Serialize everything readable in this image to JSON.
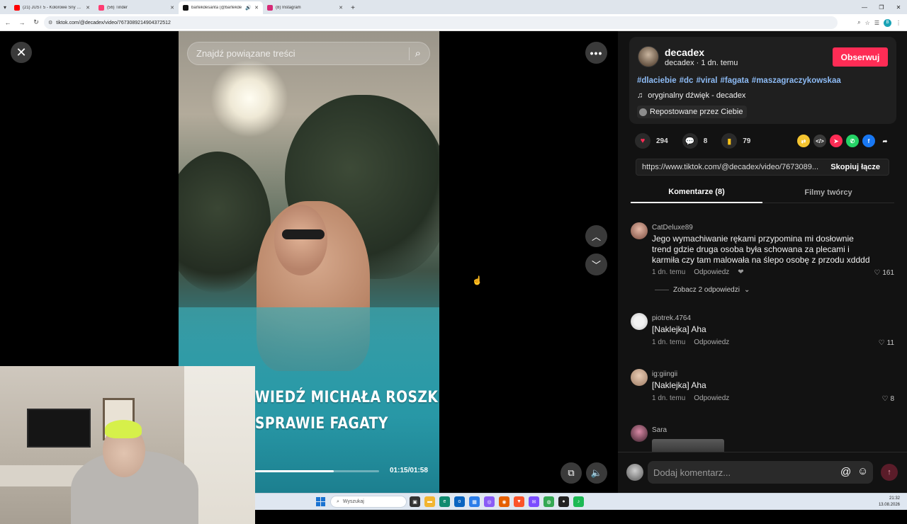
{
  "browser": {
    "tabs": [
      {
        "title": "(21) JUST 5 - Kolorowe Sny 202",
        "color": "#ff0000",
        "active": false
      },
      {
        "title": "(56) Tinder",
        "color": "#fe3c72",
        "active": false
      },
      {
        "title": "bartekdesanta (@bartekde",
        "color": "#111111",
        "active": true
      },
      {
        "title": "(8) Instagram",
        "color": "#d62976",
        "active": false
      }
    ],
    "url": "tiktok.com/@decadex/video/7673089214904372512"
  },
  "video": {
    "search_placeholder": "Znajdź powiązane treści",
    "caption_line1": "WIEDŹ MICHAŁA ROSZKI",
    "caption_line2": "SPRAWIE FAGATY",
    "timecode": "01:15/01:58",
    "progress_fraction": 0.636
  },
  "post": {
    "username": "decadex",
    "subline": "decadex · 1 dn. temu",
    "follow_label": "Obserwuj",
    "hashtags": [
      "#dlaciebie",
      "#dc",
      "#viral",
      "#fagata",
      "#maszagraczykowskaa"
    ],
    "sound": "oryginalny dźwięk - decadex",
    "repost": "Repostowane przez Ciebie",
    "likes": "294",
    "comments": "8",
    "saves": "79",
    "link": "https://www.tiktok.com/@decadex/video/7673089...",
    "copy_label": "Skopiuj łącze",
    "tab_comments": "Komentarze (8)",
    "tab_creator": "Filmy twórcy"
  },
  "comments": [
    {
      "user": "CatDeluxe89",
      "text": "Jego wymachiwanie rękami przypomina mi dosłownie trend gdzie druga osoba była schowana za plecami i karmiła czy tam malowała na ślepo osobę z przodu xdddd",
      "time": "1 dn. temu",
      "reply": "Odpowiedz",
      "likes": "161",
      "view_replies": "Zobacz 2 odpowiedzi"
    },
    {
      "user": "piotrek.4764",
      "text": "[Naklejka] Aha",
      "time": "1 dn. temu",
      "reply": "Odpowiedz",
      "likes": "11"
    },
    {
      "user": "ig:giingii",
      "text": "[Naklejka] Aha",
      "time": "1 dn. temu",
      "reply": "Odpowiedz",
      "likes": "8"
    },
    {
      "user": "Sara"
    }
  ],
  "composer": {
    "placeholder": "Dodaj komentarz..."
  },
  "taskbar": {
    "search_label": "Wyszukaj",
    "time": "21:32",
    "date": "13.08.2026"
  },
  "colors": {
    "accent": "#fe2c55",
    "hashtag": "#8dbbf5"
  }
}
